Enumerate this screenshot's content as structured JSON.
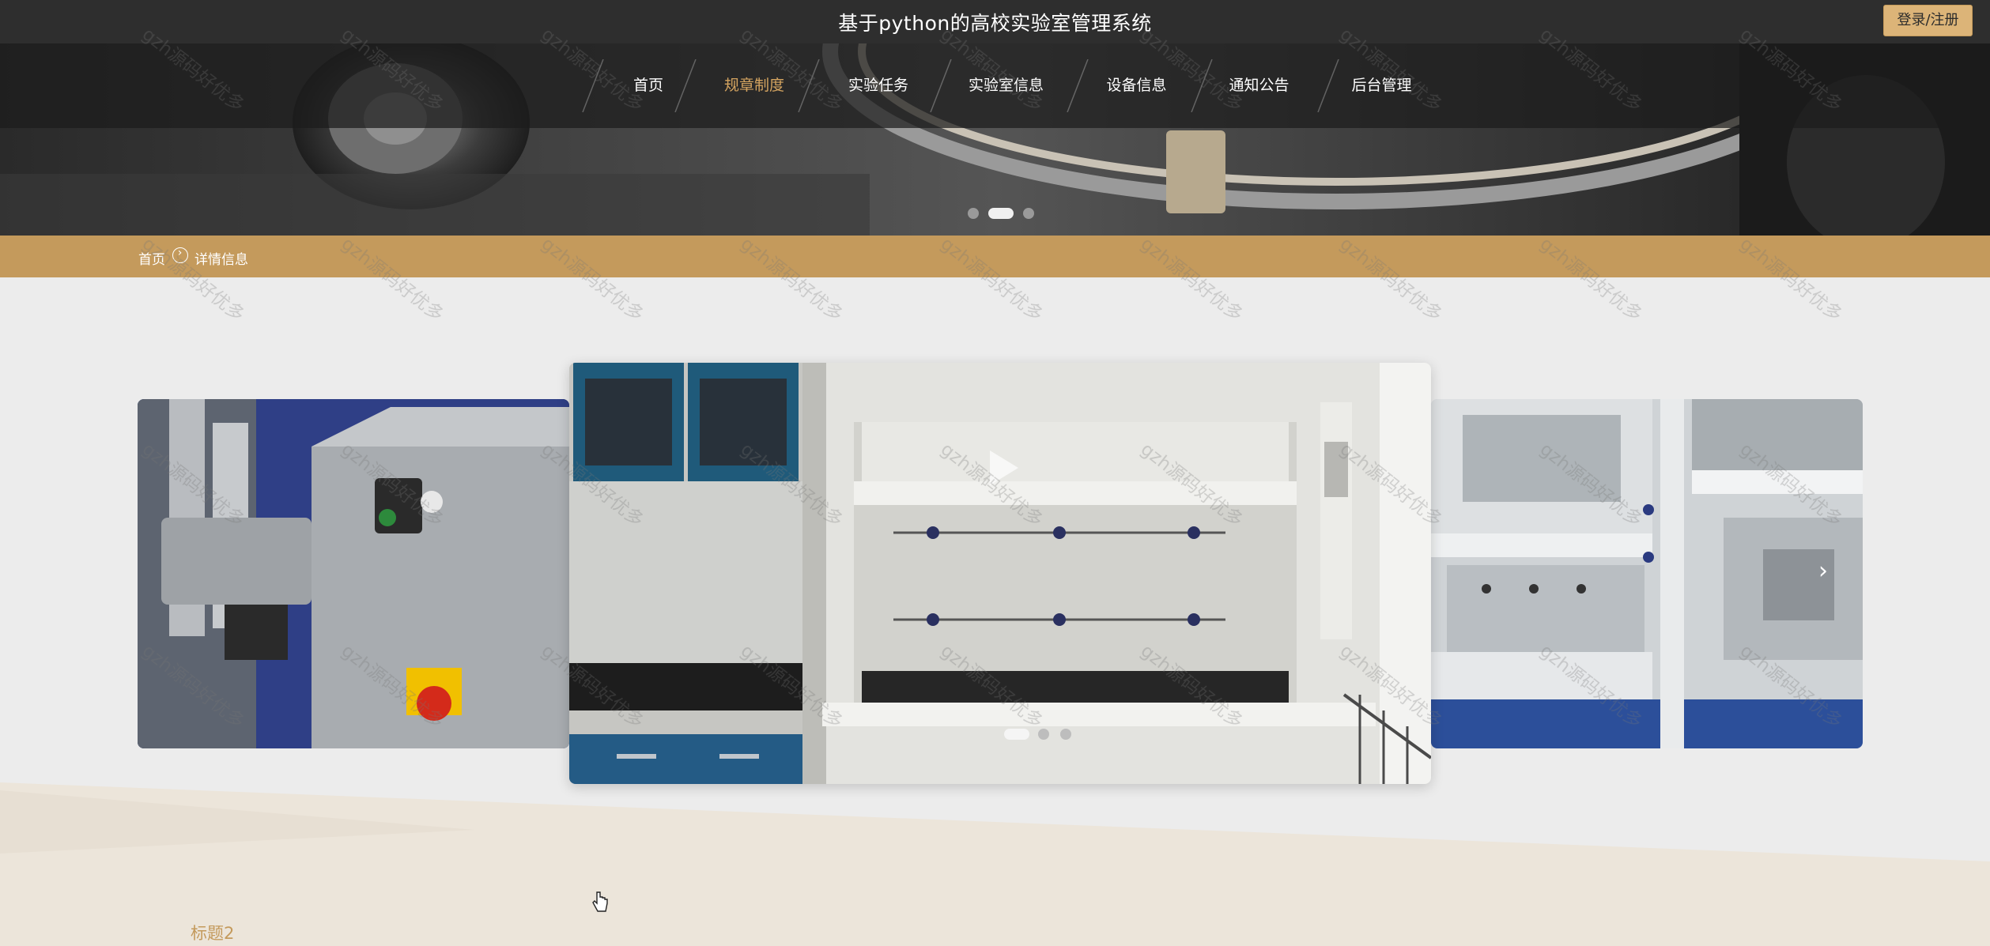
{
  "header": {
    "site_title": "基于python的高校实验室管理系统",
    "login_label": "登录/注册"
  },
  "nav": {
    "items": [
      {
        "label": "首页"
      },
      {
        "label": "规章制度"
      },
      {
        "label": "实验任务"
      },
      {
        "label": "实验室信息"
      },
      {
        "label": "设备信息"
      },
      {
        "label": "通知公告"
      },
      {
        "label": "后台管理"
      }
    ],
    "active_index": 1
  },
  "hero_carousel": {
    "slide_count": 3,
    "active_index": 1
  },
  "breadcrumb": {
    "home": "首页",
    "separator": "›",
    "current": "详情信息"
  },
  "detail_carousel": {
    "slide_count": 3,
    "active_index": 0,
    "next_arrow": "›"
  },
  "section": {
    "title": "标题2"
  },
  "watermark": "gzh源码好优多",
  "colors": {
    "topbar": "#2e2e2e",
    "accent": "#c49a5c",
    "active_nav": "#d4a460",
    "login_button": "#dcb478",
    "background": "#ececec"
  },
  "icons": {
    "play": "play-icon",
    "next": "chevron-right-icon",
    "cursor": "hand-pointer-icon"
  }
}
